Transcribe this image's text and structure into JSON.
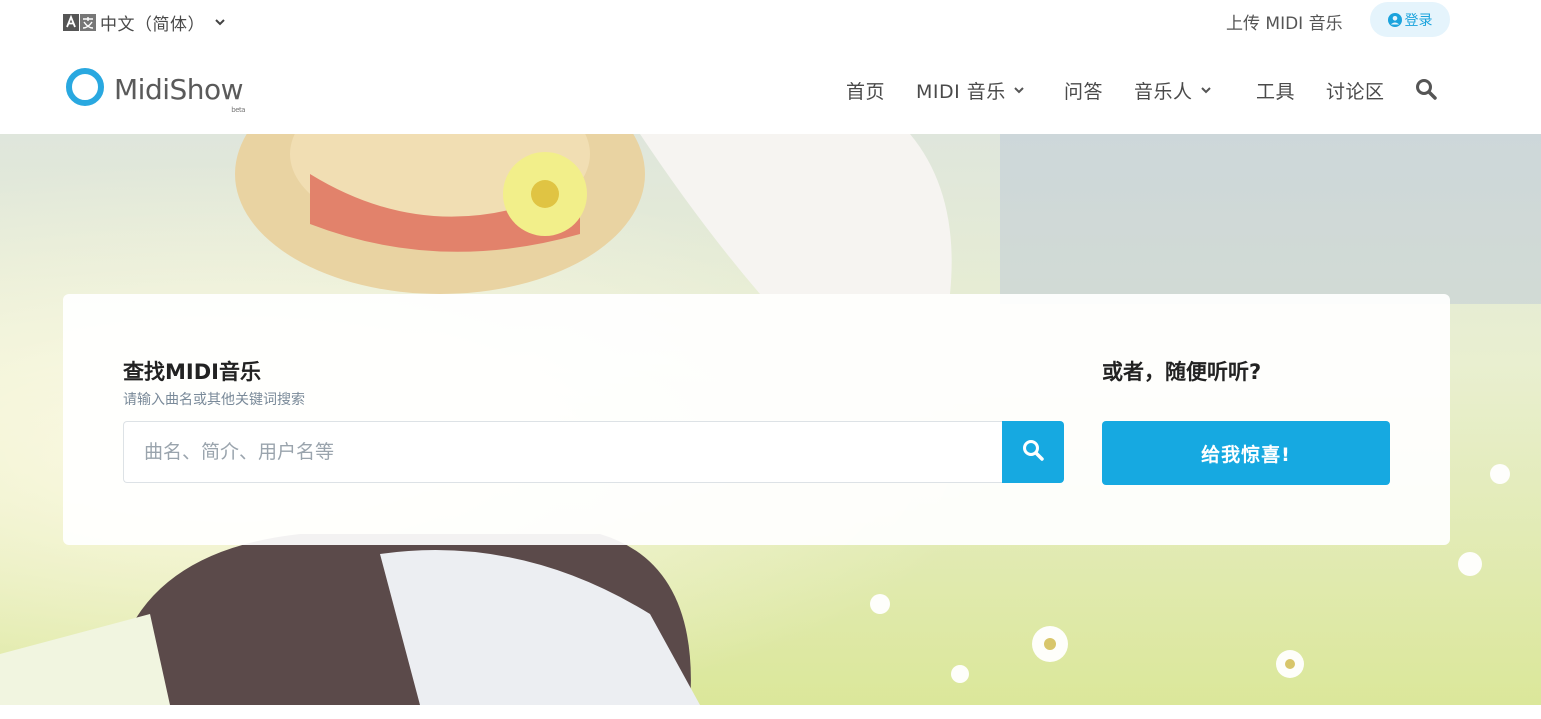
{
  "topbar": {
    "language": "中文（简体）",
    "upload_link": "上传 MIDI 音乐",
    "login": "登录"
  },
  "brand": {
    "name": "MidiShow",
    "tag": "beta"
  },
  "nav": {
    "items": [
      {
        "label": "首页"
      },
      {
        "label": "MIDI 音乐"
      },
      {
        "label": "问答"
      },
      {
        "label": "音乐人"
      },
      {
        "label": "工具"
      },
      {
        "label": "讨论区"
      }
    ]
  },
  "search": {
    "title": "查找MIDI音乐",
    "subtitle": "请输入曲名或其他关键词搜索",
    "placeholder": "曲名、简介、用户名等"
  },
  "random": {
    "title": "或者，随便听听?",
    "button": "给我惊喜!"
  },
  "colors": {
    "accent": "#16a9e1",
    "login_bg": "#e5f4fc"
  },
  "icons": [
    "translate-icon",
    "chevron-down-icon",
    "user-circle-icon",
    "logo-icon",
    "search-icon"
  ]
}
